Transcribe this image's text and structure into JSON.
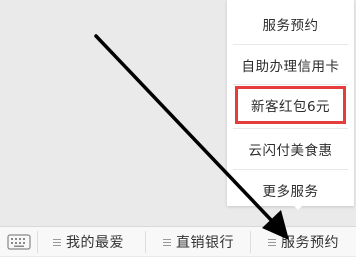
{
  "popup_menu": {
    "items": [
      {
        "label": "服务预约"
      },
      {
        "label": "自助办理信用卡"
      },
      {
        "label": "新客红包6元",
        "highlighted": true
      },
      {
        "label": "云闪付美食惠"
      },
      {
        "label": "更多服务"
      }
    ]
  },
  "bottom_bar": {
    "keyboard_icon": "keyboard-icon",
    "tabs": [
      {
        "label": "我的最爱",
        "icon": "menu-lines-icon"
      },
      {
        "label": "直销银行",
        "icon": "menu-lines-icon"
      },
      {
        "label": "服务预约",
        "icon": "menu-lines-icon"
      }
    ]
  },
  "annotation": {
    "arrow_color": "#000000",
    "highlight_color": "#e63c3c"
  }
}
